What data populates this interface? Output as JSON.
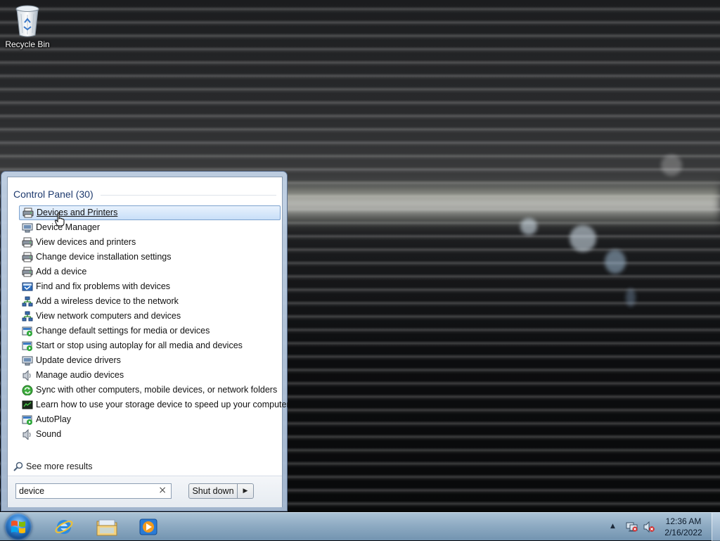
{
  "desktop": {
    "recycle_bin_label": "Recycle Bin"
  },
  "start_menu": {
    "results_header": "Control Panel (30)",
    "selected_index": 0,
    "results": [
      {
        "label": "Devices and Printers",
        "icon": "printer-icon"
      },
      {
        "label": "Device Manager",
        "icon": "device-manager-icon"
      },
      {
        "label": "View devices and printers",
        "icon": "printer-icon"
      },
      {
        "label": "Change device installation settings",
        "icon": "printer-icon"
      },
      {
        "label": "Add a device",
        "icon": "printer-icon"
      },
      {
        "label": "Find and fix problems with devices",
        "icon": "troubleshoot-icon"
      },
      {
        "label": "Add a wireless device to the network",
        "icon": "network-icon"
      },
      {
        "label": "View network computers and devices",
        "icon": "network-icon"
      },
      {
        "label": "Change default settings for media or devices",
        "icon": "autoplay-icon"
      },
      {
        "label": "Start or stop using autoplay for all media and devices",
        "icon": "autoplay-icon"
      },
      {
        "label": "Update device drivers",
        "icon": "device-manager-icon"
      },
      {
        "label": "Manage audio devices",
        "icon": "speaker-icon"
      },
      {
        "label": "Sync with other computers, mobile devices, or network folders",
        "icon": "sync-icon"
      },
      {
        "label": "Learn how to use your storage device to speed up your computer",
        "icon": "storage-icon"
      },
      {
        "label": "AutoPlay",
        "icon": "autoplay-icon"
      },
      {
        "label": "Sound",
        "icon": "speaker-icon"
      }
    ],
    "see_more_label": "See more results",
    "search": {
      "value": "device",
      "clear_glyph": "×"
    },
    "shutdown_label": "Shut down",
    "shutdown_arrow_glyph": "▶"
  },
  "taskbar": {
    "pinned": [
      {
        "name": "internet-explorer-icon"
      },
      {
        "name": "windows-explorer-icon"
      },
      {
        "name": "media-player-icon"
      }
    ],
    "tray_arrow_glyph": "▲",
    "clock": {
      "time": "12:36 AM",
      "date": "2/16/2022"
    }
  },
  "colors": {
    "results_header": "#1e3a6e",
    "selection_fill": "#c8def8",
    "selection_border": "#7da2ce",
    "taskbar": "#9fbcd6"
  }
}
